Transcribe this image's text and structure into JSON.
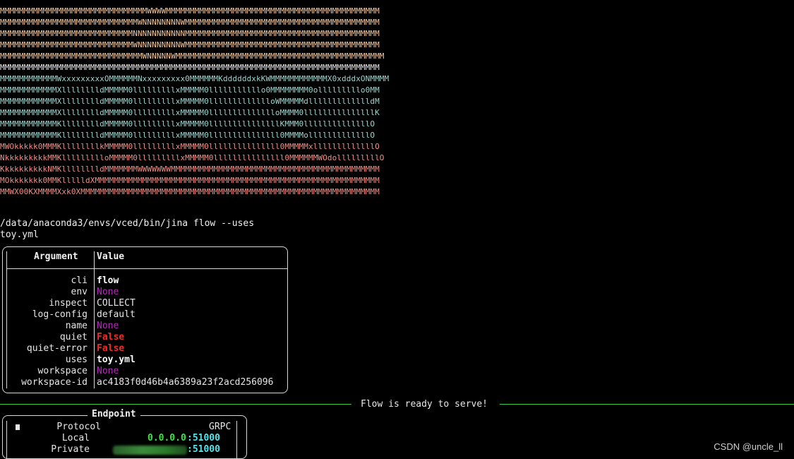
{
  "logo": {
    "lines": [
      {
        "text": "MMMMMMMMMMMMMMMMMMMMMMMMMMMMMMMWWWWMMMMMMMMMMMMMMMMMMMMMMMMMMMMMMMMMMMMMMMMMMMMM",
        "tone": "peach"
      },
      {
        "text": "MMMMMMMMMMMMMMMMMMMMMMMMMMMMMWNNNNNNNNWMMMMMMMMMMMMMMMMMMMMMMMMMMMMMMMMMMMMMMMMM",
        "tone": "peach"
      },
      {
        "text": "MMMMMMMMMMMMMMMMMMMMMMMMMMMMNNNNNNNNNNNMMMMMMMMMMMMMMMMMMMMMMMMMMMMMMMMMMMMMMMMM",
        "tone": "peach"
      },
      {
        "text": "MMMMMMMMMMMMMMMMMMMMMMMMMMMMWNNNNNNNNNWMMMMMMMMMMMMMMMMMMMMMMMMMMMMMMMMMMMMMMMMM",
        "tone": "peach"
      },
      {
        "text": "MMMMMMMMMMMMMMMMMMMMMMMMMMMMMMWNNNNNWMMMMMMMMMMMMMMMMMMMMMMMMMMMMMMMMMMMMMMMMMMMM",
        "tone": "peach"
      },
      {
        "text": "MMMMMMMMMMMMMMMMMMMMMMMMMMMMMMMMMMMMMMMMMMMMMMMMMMMMMMMMMMMMMMMMMMMMMMMMMMMMMMMM",
        "tone": "plain"
      },
      {
        "text": "MMMMMMMMMMMMWxxxxxxxxxOMMMMMMNxxxxxxxxx0MMMMMMKddddddxkKWMMMMMMMMMMMMX0xdddxONMMMM",
        "tone": "teal"
      },
      {
        "text": "MMMMMMMMMMMMXlllllllldMMMMM0lllllllllxMMMMM0lllllllllllo0MMMMMMMM0olllllllllo0MM",
        "tone": "teal"
      },
      {
        "text": "MMMMMMMMMMMMXlllllllldMMMMM0lllllllllxMMMMM0llllllllllllloWMMMMMdllllllllllllldM",
        "tone": "teal"
      },
      {
        "text": "MMMMMMMMMMMMXlllllllldMMMMM0lllllllllxMMMMM0lllllllllllllloMMMM0lllllllllllllllK",
        "tone": "teal"
      },
      {
        "text": "MMMMMMMMMMMMKlllllllldMMMMM0lllllllllxMMMMM0lllllllllllllllKMMM0llllllllllllllO",
        "tone": "teal"
      },
      {
        "text": "MMMMMMMMMMMMKlllllllldMMMMM0lllllllllxMMMMM0lllllllllllllll0MMMMolllllllllllllO",
        "tone": "teal"
      },
      {
        "text": "MWOkkkkk0MMMKllllllllkMMMMM0lllllllllxMMMMM0lllllllllllllll0MMMMMxlllllllllllllO",
        "tone": "salmon"
      },
      {
        "text": "NkkkkkkkkkMMKllllllllloMMMMM0lllllllllxMMMMM0lllllllllllllll0MMMMMMWOdolllllllllO",
        "tone": "salmon"
      },
      {
        "text": "KkkkkkkkkkNMKlllllllldMMMMMMMWWWWWWWMMMMMMMMMMMMMMMMMMMMMMMMMMMMMMMMMMMMMMMMMMMM",
        "tone": "salmon"
      },
      {
        "text": "MOkkkkkkk0MMKllllldXMMMMMMMMMMMMMMMMMMMMMMMMMMMMMMMMMMMMMMMMMMMMMMMMMMMMMMMMMMMM",
        "tone": "salmon"
      },
      {
        "text": "MMWX00KXMMMMXxk0XMMMMMMMMMMMMMMMMMMMMMMMMMMMMMMMMMMMMMMMMMMMMMMMMMMMMMMMMMMMMMMM",
        "tone": "salmon"
      }
    ]
  },
  "command": {
    "line1": "/data/anaconda3/envs/vced/bin/jina flow --uses",
    "line2": "toy.yml"
  },
  "arg_table": {
    "header_argument": "Argument",
    "header_value": "Value",
    "rows": [
      {
        "key": "cli",
        "value": "flow",
        "style": "white"
      },
      {
        "key": "env",
        "value": "None",
        "style": "none"
      },
      {
        "key": "inspect",
        "value": "COLLECT",
        "style": "plain"
      },
      {
        "key": "log-config",
        "value": "default",
        "style": "plain"
      },
      {
        "key": "name",
        "value": "None",
        "style": "none"
      },
      {
        "key": "quiet",
        "value": "False",
        "style": "false"
      },
      {
        "key": "quiet-error",
        "value": "False",
        "style": "false"
      },
      {
        "key": "uses",
        "value": "toy.yml",
        "style": "white"
      },
      {
        "key": "workspace",
        "value": "None",
        "style": "none"
      },
      {
        "key": "workspace-id",
        "value": "ac4183f0d46b4a6389a23f2acd256096",
        "style": "plain"
      }
    ]
  },
  "status": {
    "ready_text": "Flow is ready to serve!"
  },
  "endpoint": {
    "title": "Endpoint",
    "protocol_label": "Protocol",
    "protocol_value": "GRPC",
    "local_label": "Local",
    "local_host": "0.0.0.0",
    "local_port": ":51000",
    "private_label": "Private",
    "private_port": ":51000"
  },
  "watermark": "CSDN @uncle_ll",
  "colors": {
    "background": "#000000",
    "rule": "#3fc93f",
    "none_value": "#b02cb5",
    "false_value": "#ef2a2a",
    "host": "#3fe04a",
    "port": "#56e3e8"
  }
}
